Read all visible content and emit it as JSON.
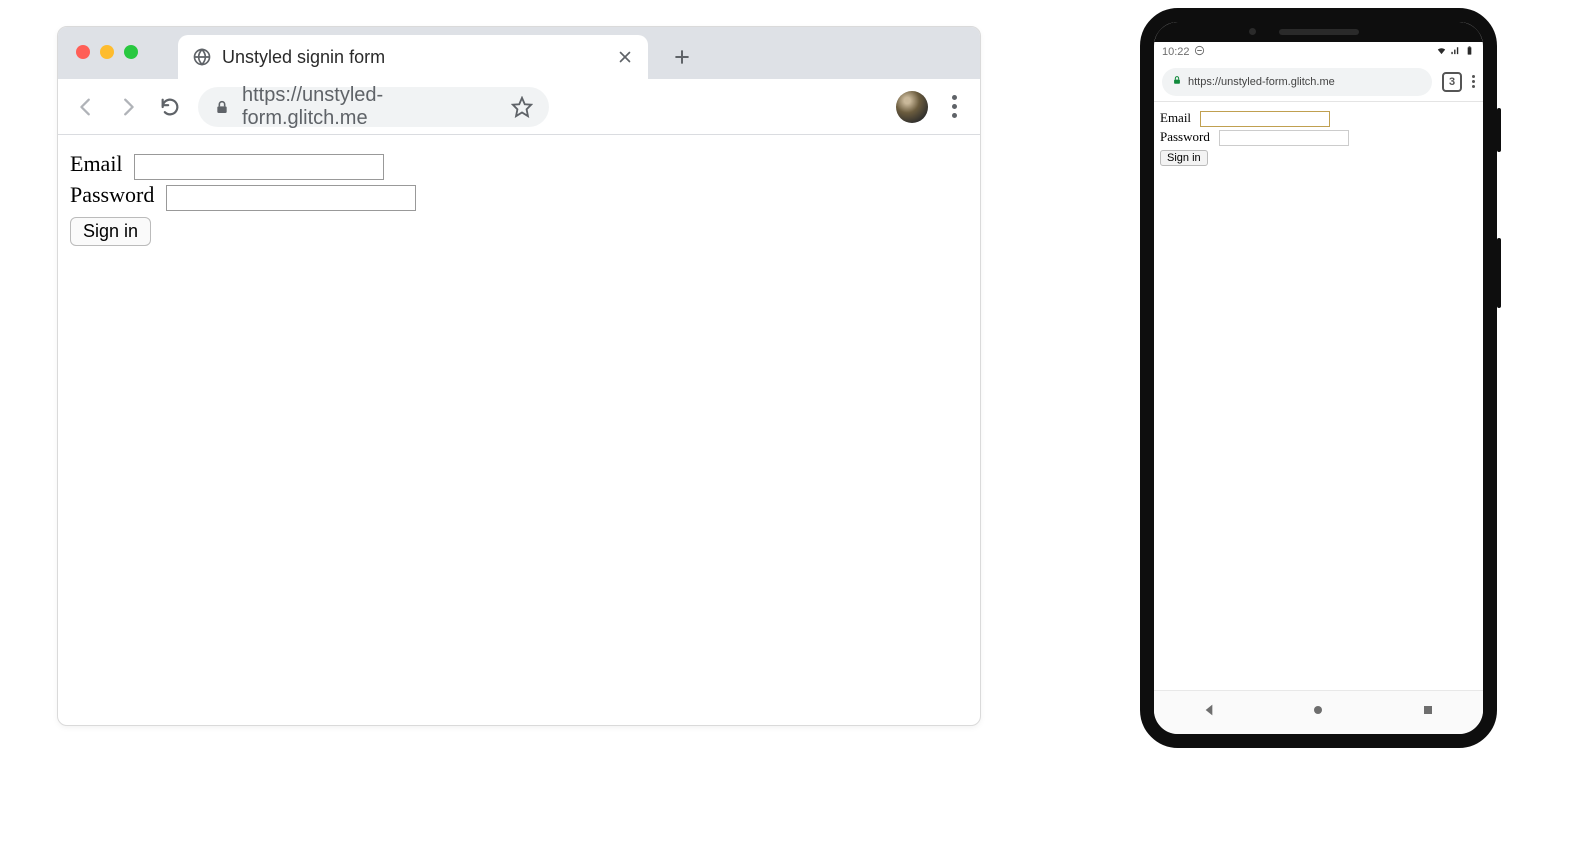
{
  "desktop": {
    "tab": {
      "title": "Unstyled signin form"
    },
    "url": "https://unstyled-form.glitch.me",
    "form": {
      "email_label": "Email",
      "password_label": "Password",
      "submit_label": "Sign in"
    }
  },
  "mobile": {
    "status": {
      "time": "10:22"
    },
    "url_display": "https://unstyled-form.glitch.me",
    "tab_count": "3",
    "form": {
      "email_label": "Email",
      "password_label": "Password",
      "submit_label": "Sign in"
    }
  }
}
